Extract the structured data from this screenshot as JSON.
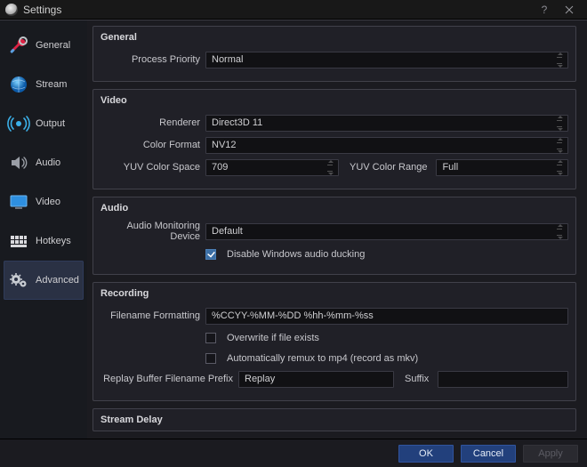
{
  "window": {
    "title": "Settings",
    "help_tooltip": "?",
    "close_tooltip": "Close"
  },
  "sidebar": {
    "items": [
      {
        "key": "general",
        "label": "General"
      },
      {
        "key": "stream",
        "label": "Stream"
      },
      {
        "key": "output",
        "label": "Output"
      },
      {
        "key": "audio",
        "label": "Audio"
      },
      {
        "key": "video",
        "label": "Video"
      },
      {
        "key": "hotkeys",
        "label": "Hotkeys"
      },
      {
        "key": "advanced",
        "label": "Advanced"
      }
    ],
    "selected": "advanced"
  },
  "groups": {
    "general": {
      "title": "General",
      "process_priority_label": "Process Priority",
      "process_priority_value": "Normal"
    },
    "video": {
      "title": "Video",
      "renderer_label": "Renderer",
      "renderer_value": "Direct3D 11",
      "color_format_label": "Color Format",
      "color_format_value": "NV12",
      "yuv_color_space_label": "YUV Color Space",
      "yuv_color_space_value": "709",
      "yuv_color_range_label": "YUV Color Range",
      "yuv_color_range_value": "Full"
    },
    "audio": {
      "title": "Audio",
      "monitoring_device_label": "Audio Monitoring Device",
      "monitoring_device_value": "Default",
      "disable_ducking_label": "Disable Windows audio ducking",
      "disable_ducking_checked": true
    },
    "recording": {
      "title": "Recording",
      "filename_formatting_label": "Filename Formatting",
      "filename_formatting_value": "%CCYY-%MM-%DD %hh-%mm-%ss",
      "overwrite_label": "Overwrite if file exists",
      "overwrite_checked": false,
      "auto_remux_label": "Automatically remux to mp4 (record as mkv)",
      "auto_remux_checked": false,
      "replay_prefix_label": "Replay Buffer Filename Prefix",
      "replay_prefix_value": "Replay",
      "replay_suffix_label": "Suffix",
      "replay_suffix_value": ""
    },
    "stream_delay": {
      "title": "Stream Delay"
    }
  },
  "buttons": {
    "ok": "OK",
    "cancel": "Cancel",
    "apply": "Apply"
  }
}
